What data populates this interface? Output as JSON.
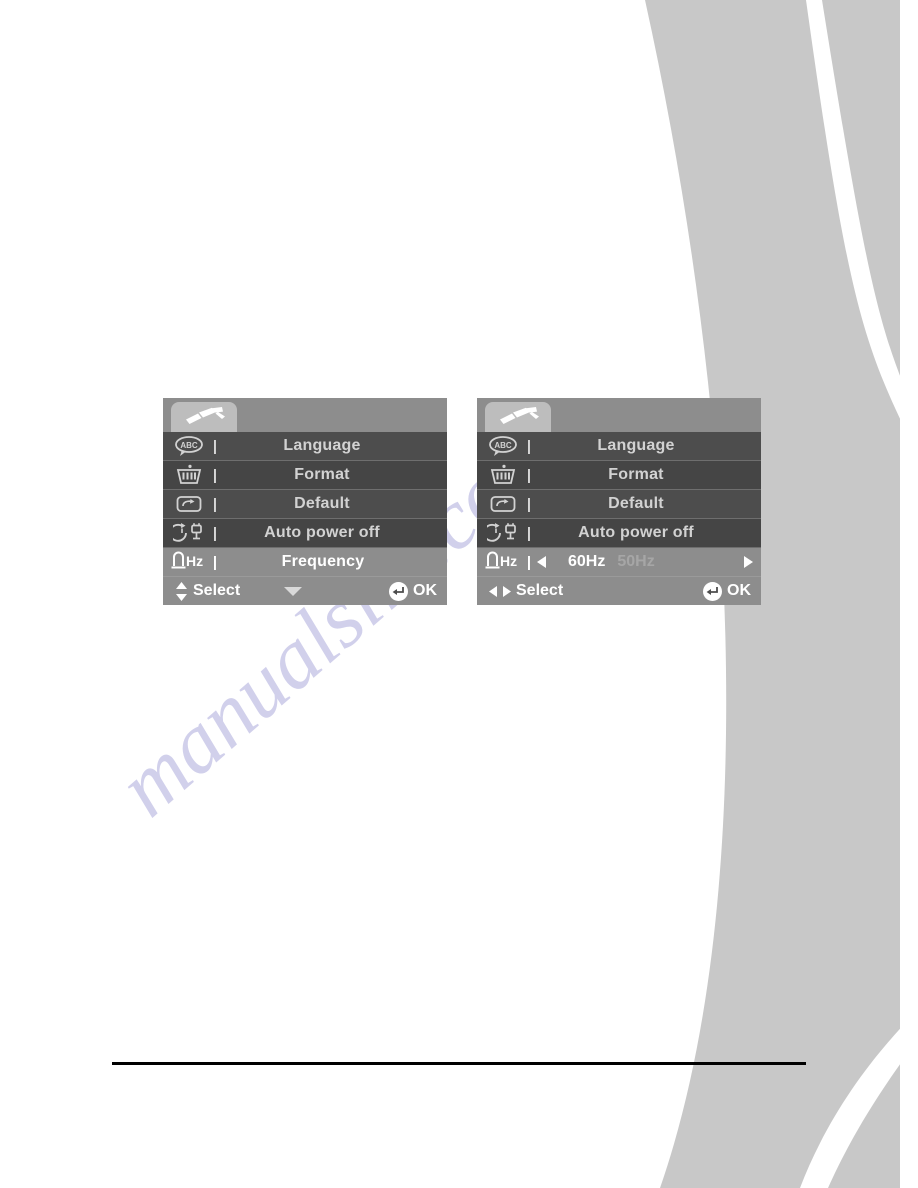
{
  "page": {
    "background_color": "#ffffff",
    "decoration_color": "#c8c8c8",
    "rule_color": "#000000",
    "watermark_text": "manualslib.com",
    "watermark_color": "#c9c8e8"
  },
  "osd_panels": [
    {
      "id": "left",
      "name": "setup-menu-navigation-state",
      "tab": {
        "icon": "screwdriver-icon",
        "active": true
      },
      "rows": [
        {
          "icon": "abc-speech-bubble-icon",
          "label": "Language",
          "selected": false,
          "type": "label"
        },
        {
          "icon": "format-card-icon",
          "label": "Format",
          "selected": false,
          "type": "label"
        },
        {
          "icon": "default-reset-icon",
          "label": "Default",
          "selected": false,
          "type": "label"
        },
        {
          "icon": "auto-power-off-icon",
          "label": "Auto power off",
          "selected": false,
          "type": "label"
        },
        {
          "icon": "frequency-hz-icon",
          "label": "Frequency",
          "selected": true,
          "type": "label"
        }
      ],
      "footer": {
        "nav_icon": "up-down-arrows-icon",
        "nav_label": "Select",
        "mid_icon": "chevron-down-icon",
        "confirm_icon": "enter-ok-icon",
        "confirm_label": "OK"
      }
    },
    {
      "id": "right",
      "name": "setup-menu-frequency-value-state",
      "tab": {
        "icon": "screwdriver-icon",
        "active": true
      },
      "rows": [
        {
          "icon": "abc-speech-bubble-icon",
          "label": "Language",
          "selected": false,
          "type": "label"
        },
        {
          "icon": "format-card-icon",
          "label": "Format",
          "selected": false,
          "type": "label"
        },
        {
          "icon": "default-reset-icon",
          "label": "Default",
          "selected": false,
          "type": "label"
        },
        {
          "icon": "auto-power-off-icon",
          "label": "Auto power off",
          "selected": false,
          "type": "label"
        },
        {
          "icon": "frequency-hz-icon",
          "label": "Frequency",
          "selected": true,
          "type": "value-picker",
          "left_arrow_icon": "arrow-left-icon",
          "right_arrow_icon": "arrow-right-icon",
          "options": [
            {
              "label": "60Hz",
              "selected": true
            },
            {
              "label": "50Hz",
              "selected": false
            }
          ]
        }
      ],
      "footer": {
        "nav_icon": "left-right-arrows-icon",
        "nav_label": "Select",
        "mid_icon": null,
        "confirm_icon": "enter-ok-icon",
        "confirm_label": "OK"
      }
    }
  ]
}
